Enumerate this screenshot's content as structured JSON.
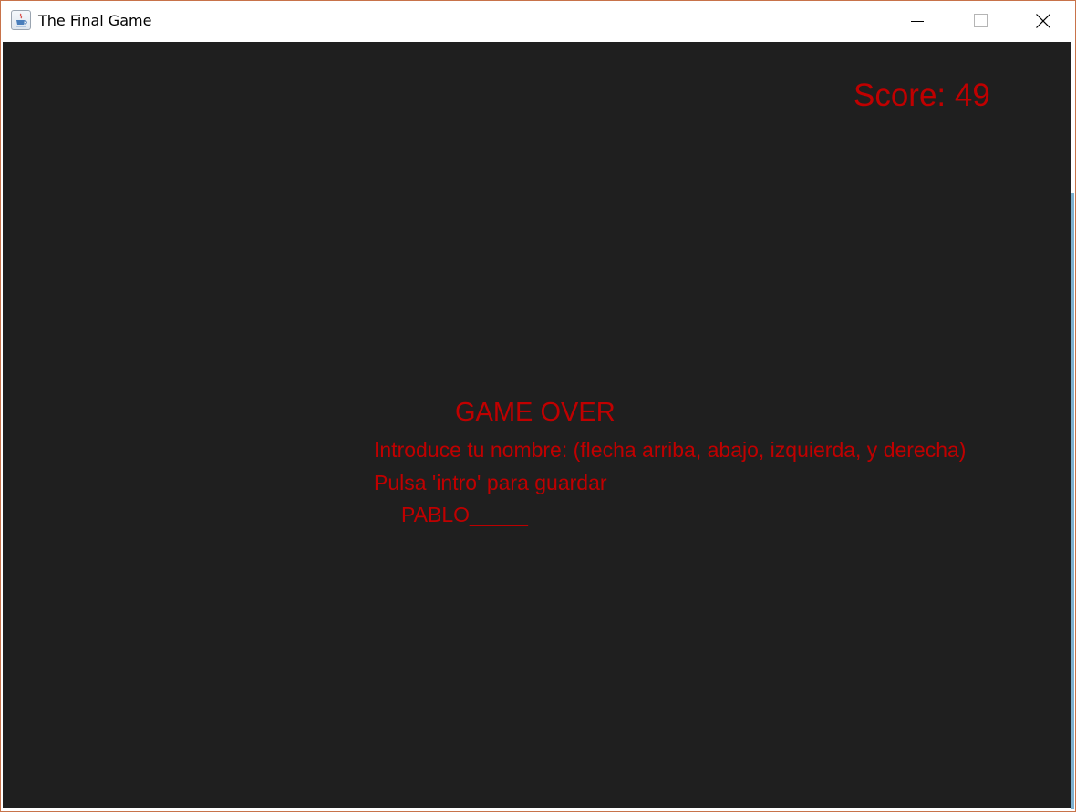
{
  "window": {
    "title": "The Final Game",
    "icon": "java-cup-icon",
    "controls": [
      "minimize-icon",
      "maximize-icon",
      "close-icon"
    ]
  },
  "game": {
    "background_color": "#1f1f1f",
    "text_color": "#c00000",
    "score_label": "Score:",
    "score_value": "49",
    "game_over": "GAME OVER",
    "name_prompt": "Introduce tu nombre: (flecha arriba, abajo, izquierda, y derecha)",
    "save_prompt": "Pulsa 'intro' para guardar",
    "name_entry": "PABLO_____"
  }
}
